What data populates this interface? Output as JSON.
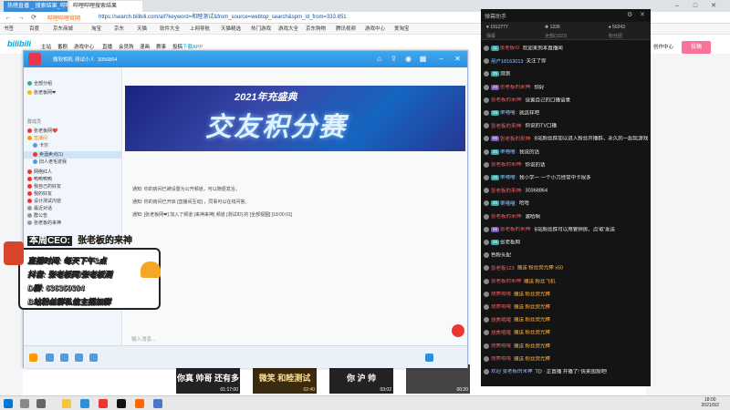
{
  "browser": {
    "tabs": [
      "热榜直播 _ 搜索结果_哔哩哔哩_bilibili",
      "哔哩哔哩搜索结果"
    ],
    "url": "https://search.bilibili.com/all?keyword=和睦测试&from_source=webtop_search&spm_id_from=333.851",
    "url_site": "哔哩哔哩官网",
    "bookmarks": [
      "书签",
      "百度",
      "京东商城",
      "淘宝",
      "京东",
      "天猫",
      "软件大全",
      "上网导航",
      "天猫精选",
      "热门游戏",
      "游戏大全",
      "京东购物",
      "腾讯视频",
      "游戏中心",
      "爱淘宝"
    ]
  },
  "bili": {
    "nav": [
      "主站",
      "番剧",
      "游戏中心",
      "直播",
      "会员购",
      "漫画",
      "赛事",
      "投稿",
      "下载APP"
    ],
    "upload": "投稿",
    "history": "历史",
    "creator": "创作中心"
  },
  "thumbs": [
    {
      "text": "你真 帅哥 还有多远",
      "time": "01:17:00"
    },
    {
      "text": "微笑 和睦测试",
      "time": "02:40"
    },
    {
      "text": "你 沪 帅",
      "time": "03:02"
    },
    {
      "text": "",
      "time": "00:20"
    }
  ],
  "qq": {
    "title": "微软相机·测试小人",
    "count": "3056864",
    "sidebar": [
      "全部分组",
      "张老板网❤",
      "群成员",
      "张老板网❤️",
      "直播间",
      "卡尔",
      "卖酒卖点(1)",
      "旧人老毛遂我",
      "网络红人",
      "鸭鸭鸭鸭",
      "我自己的好友",
      "我的好友",
      "设计测试内容",
      "最近对话",
      "群公告",
      "张老板的来神"
    ],
    "banner_top": "2021年充盛典",
    "banner": "交友积分赛",
    "notes": [
      "通知: 你的房间已被设置为公开频道，可以随便发言。",
      "通知: 你的房间已开启 [直播间互动] ，同事可以在线问答。",
      "通知: [张老板网❤] 加入了频道 [来神来神] 频道 [测试ID] 的 [全部视图] [18:00:01]"
    ],
    "input_placeholder": "输入消息..."
  },
  "overlay": {
    "title_l": "本周CEO:",
    "title_n": "张老板的来神",
    "lines": [
      "直播时间: 每天下午3点",
      "抖音: 张老板网/张老板测",
      "D群: 636359384",
      "B站粉丝群私信主播加群"
    ]
  },
  "live": {
    "title": "弹幕助手",
    "stats": [
      "1912777",
      "1226",
      "50243"
    ],
    "tabs": [
      "弹幕",
      "全部(1022)",
      "粉丝团"
    ],
    "rows": [
      {
        "badge": "g",
        "level": "11",
        "name": "张老板の",
        "text": "欢迎来到本直播间",
        "color": "nm"
      },
      {
        "badge": "b",
        "level": "",
        "name": "用户18163013",
        "text": "关注了你",
        "color": "nm2"
      },
      {
        "badge": "g",
        "level": "25",
        "name": "",
        "text": "测测",
        "color": "tx"
      },
      {
        "badge": "p",
        "level": "20",
        "name": "张老板的来神:",
        "text": "你好",
        "color": "nm"
      },
      {
        "badge": "o",
        "level": "",
        "name": "张老板的来神:",
        "text": "设置自己的口播语录",
        "color": "nm"
      },
      {
        "badge": "g",
        "level": "25",
        "name": "栗喵喵:",
        "text": "就这样吧",
        "color": "nm2"
      },
      {
        "badge": "o",
        "level": "",
        "name": "张老板的来神:",
        "text": "你说的TV口播",
        "color": "nm"
      },
      {
        "badge": "p",
        "level": "56",
        "name": "张老板的来神:",
        "text": "B站粉丝群加以进入粉丝开播群，永久的一起玩游戏",
        "color": "nm"
      },
      {
        "badge": "g",
        "level": "25",
        "name": "栗喵喵:",
        "text": "我说的话",
        "color": "nm2"
      },
      {
        "badge": "o",
        "level": "",
        "name": "张老板的来神:",
        "text": "你说的话",
        "color": "nm"
      },
      {
        "badge": "g",
        "level": "25",
        "name": "栗喵喵:",
        "text": "我小学一 一个小刀经常中卡很多",
        "color": "nm2"
      },
      {
        "badge": "o",
        "level": "",
        "name": "张老板的来神:",
        "text": "30368864",
        "color": "nm"
      },
      {
        "badge": "g",
        "level": "25",
        "name": "栗喵喵:",
        "text": "哈哈",
        "color": "nm2"
      },
      {
        "badge": "o",
        "level": "",
        "name": "张老板的来神:",
        "text": "滚哈啊",
        "color": "nm"
      },
      {
        "badge": "p",
        "level": "56",
        "name": "张老板的来神:",
        "text": "B站粉丝群可以用管钟房，点'取'发送",
        "color": "nm"
      },
      {
        "badge": "g",
        "level": "25",
        "name": "",
        "text": "张老板网",
        "color": "tx"
      },
      {
        "badge": "o",
        "level": "",
        "name": "",
        "text": "色粉头配",
        "color": "tx"
      },
      {
        "badge": "b",
        "level": "",
        "name": "张老板123",
        "text": "赠送 粉丝荧光棒 x50",
        "color": "gift"
      },
      {
        "badge": "p",
        "level": "",
        "name": "张老板的来神",
        "text": "赠送 粉丝飞机",
        "color": "gift"
      },
      {
        "badge": "g",
        "level": "",
        "name": "烧焦哦哦",
        "text": "赠送 粉丝荧光棒",
        "color": "gift"
      },
      {
        "badge": "g",
        "level": "",
        "name": "烧焦哦哦",
        "text": "赠送 粉丝荧光棒",
        "color": "gift"
      },
      {
        "badge": "g",
        "level": "",
        "name": "烧焦哦哦",
        "text": "赠送 粉丝荧光棒",
        "color": "gift"
      },
      {
        "badge": "g",
        "level": "",
        "name": "烧焦哦哦",
        "text": "赠送 粉丝荧光棒",
        "color": "gift"
      },
      {
        "badge": "g",
        "level": "",
        "name": "烧焦哦哦",
        "text": "赠送 粉丝荧光棒",
        "color": "gift"
      },
      {
        "badge": "g",
        "level": "",
        "name": "烧焦哦哦",
        "text": "赠送 粉丝荧光棒",
        "color": "gift"
      },
      {
        "badge": "b",
        "level": "",
        "name": "欢迎 张老板的来神",
        "text": "TD · 正直播 开播了! 快来围观吧!",
        "color": "nm2"
      }
    ]
  },
  "clock": {
    "time": "18:00",
    "date": "2021/9/2"
  }
}
